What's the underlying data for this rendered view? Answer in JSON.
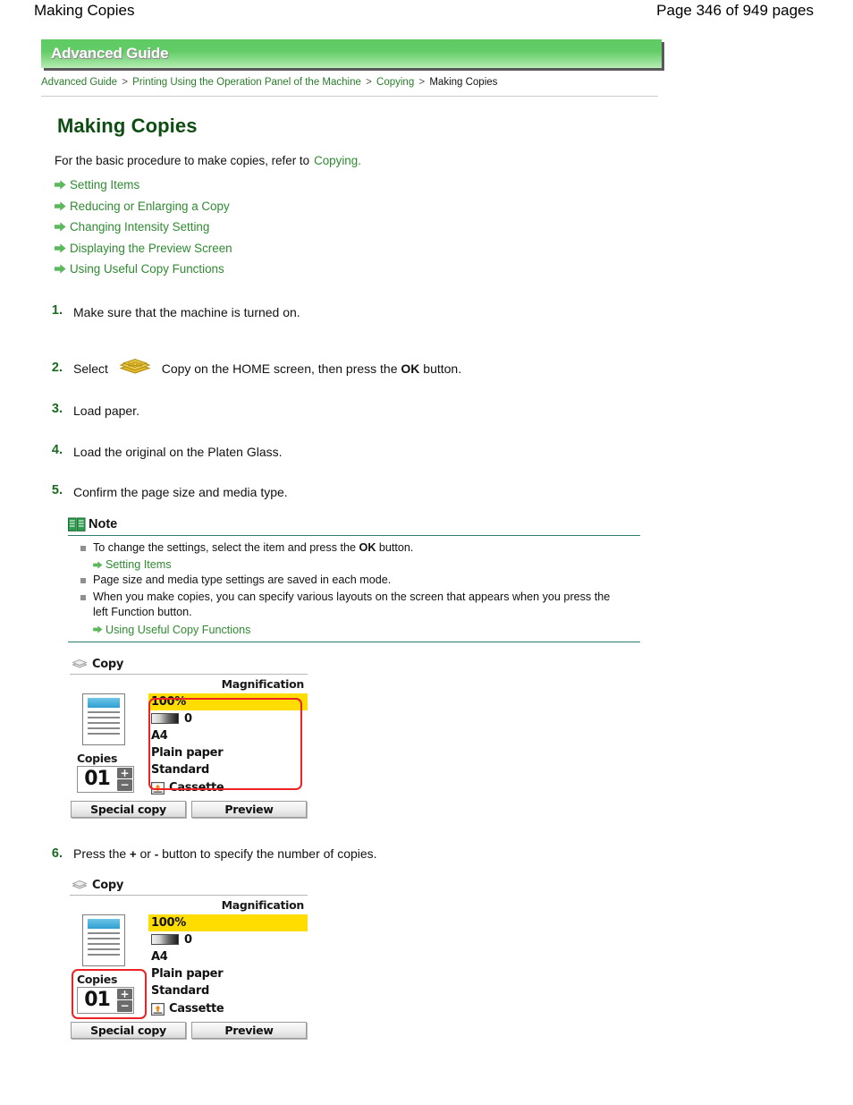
{
  "page_header": {
    "title": "Making Copies",
    "page_info": "Page 346 of 949 pages"
  },
  "banner": {
    "label": "Advanced Guide"
  },
  "breadcrumb": {
    "items": [
      {
        "label": "Advanced Guide",
        "current": false
      },
      {
        "label": "Printing Using the Operation Panel of the Machine",
        "current": false
      },
      {
        "label": "Copying",
        "current": false
      },
      {
        "label": "Making Copies",
        "current": true
      }
    ],
    "separator": ">"
  },
  "doc": {
    "title": "Making Copies",
    "intro_text": "For the basic procedure to make copies, refer to",
    "intro_link": "Copying",
    "intro_period": "."
  },
  "link_list": [
    {
      "label": "Setting Items"
    },
    {
      "label": "Reducing or Enlarging a Copy"
    },
    {
      "label": "Changing Intensity Setting"
    },
    {
      "label": "Displaying the Preview Screen"
    },
    {
      "label": "Using Useful Copy Functions"
    }
  ],
  "steps": [
    {
      "num": "1.",
      "text": "Make sure that the machine is turned on."
    },
    {
      "num": "2.",
      "text_before": "Select",
      "text_middle": "Copy on the HOME screen, then press the",
      "ok": "OK",
      "text_after": "button."
    },
    {
      "num": "3.",
      "text": "Load paper."
    },
    {
      "num": "4.",
      "text": "Load the original on the Platen Glass."
    },
    {
      "num": "5.",
      "text": "Confirm the page size and media type."
    },
    {
      "num": "6.",
      "text_before": "Press the",
      "plus": "+",
      "text_or": "or",
      "minus": "-",
      "text_after": "button to specify the number of copies."
    }
  ],
  "note": {
    "title": "Note",
    "items": [
      {
        "text_before": "To change the settings, select the item and press the",
        "ok": "OK",
        "text_after": "button.",
        "sublink": "Setting Items"
      },
      {
        "text_before": "Page size and media type settings are saved in each mode.",
        "sublink": null
      },
      {
        "text_before": "When you make copies, you can specify various layouts on the screen that appears when you press the left Function button.",
        "sublink": "Using Useful Copy Functions"
      }
    ]
  },
  "lcd_screens": [
    {
      "title": "Copy",
      "magnification_label": "Magnification",
      "copies_label": "Copies",
      "copies_value": "01",
      "stepper_plus": "+",
      "stepper_minus": "−",
      "settings": {
        "magnification_value": "100%",
        "intensity_value": "0",
        "page_size": "A4",
        "media_type": "Plain paper",
        "print_quality": "Standard"
      },
      "paper_source": "Cassette",
      "buttons": [
        "Special copy",
        "Preview"
      ],
      "highlight": "settings"
    },
    {
      "title": "Copy",
      "magnification_label": "Magnification",
      "copies_label": "Copies",
      "copies_value": "01",
      "stepper_plus": "+",
      "stepper_minus": "−",
      "settings": {
        "magnification_value": "100%",
        "intensity_value": "0",
        "page_size": "A4",
        "media_type": "Plain paper",
        "print_quality": "Standard"
      },
      "paper_source": "Cassette",
      "buttons": [
        "Special copy",
        "Preview"
      ],
      "highlight": "copies"
    }
  ],
  "colors": {
    "banner_green_top": "#5fcb63",
    "banner_green_bottom": "#bbeeba",
    "link_green": "#2f8a31",
    "title_green": "#0d4d12",
    "highlight_yellow": "#ffdd00",
    "redbox": "#ee2222",
    "note_rule": "#2f7d6e"
  }
}
